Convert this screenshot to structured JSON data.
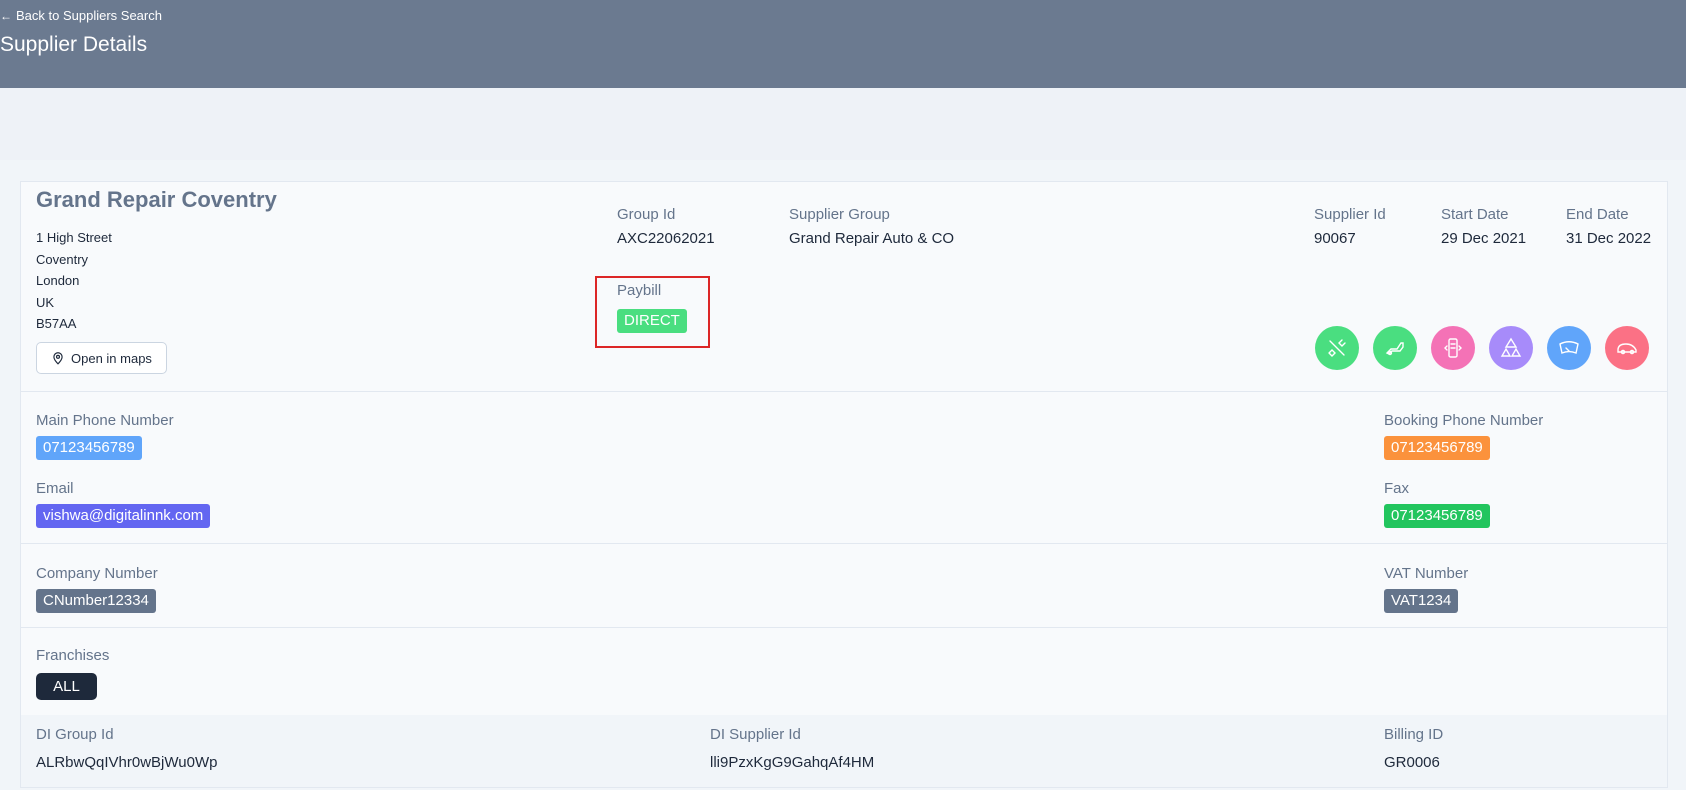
{
  "header": {
    "back_link": "Back to Suppliers Search",
    "title": "Supplier Details"
  },
  "supplier": {
    "name": "Grand Repair Coventry",
    "address": [
      "1 High Street",
      "Coventry",
      "London",
      "UK",
      "B57AA"
    ],
    "open_maps_label": "Open in maps",
    "group_id_label": "Group Id",
    "group_id": "AXC22062021",
    "supplier_group_label": "Supplier Group",
    "supplier_group": "Grand Repair Auto & CO",
    "supplier_id_label": "Supplier Id",
    "supplier_id": "90067",
    "start_date_label": "Start Date",
    "start_date": "29 Dec 2021",
    "end_date_label": "End Date",
    "end_date": "31 Dec 2022",
    "paybill_label": "Paybill",
    "paybill": "DIRECT"
  },
  "service_icons": [
    {
      "name": "tools-icon",
      "color": "#4ade80"
    },
    {
      "name": "exhaust-icon",
      "color": "#4ade80"
    },
    {
      "name": "phone-repair-icon",
      "color": "#f472b6"
    },
    {
      "name": "tyres-icon",
      "color": "#a78bfa"
    },
    {
      "name": "windscreen-icon",
      "color": "#60a5fa"
    },
    {
      "name": "car-body-icon",
      "color": "#fb7185"
    }
  ],
  "contact": {
    "main_phone_label": "Main Phone Number",
    "main_phone": "07123456789",
    "booking_phone_label": "Booking Phone Number",
    "booking_phone": "07123456789",
    "email_label": "Email",
    "email": "vishwa@digitalinnk.com",
    "fax_label": "Fax",
    "fax": "07123456789"
  },
  "company": {
    "company_number_label": "Company Number",
    "company_number": "CNumber12334",
    "vat_label": "VAT Number",
    "vat": "VAT1234"
  },
  "franchises": {
    "label": "Franchises",
    "value": "ALL"
  },
  "di": {
    "group_id_label": "DI Group Id",
    "group_id": "ALRbwQqIVhr0wBjWu0Wp",
    "supplier_id_label": "DI Supplier Id",
    "supplier_id": "lli9PzxKgG9GahqAf4HM",
    "billing_id_label": "Billing ID",
    "billing_id": "GR0006"
  },
  "colors": {
    "header_bg": "#6b7a90",
    "paybill_badge": "#4ade80",
    "main_phone_badge": "#60a5fa",
    "booking_phone_badge": "#fb923c",
    "email_badge": "#6366f1",
    "fax_badge": "#22c55e",
    "company_badge": "#64748b",
    "vat_badge": "#64748b",
    "highlight_border": "#dc2626"
  }
}
